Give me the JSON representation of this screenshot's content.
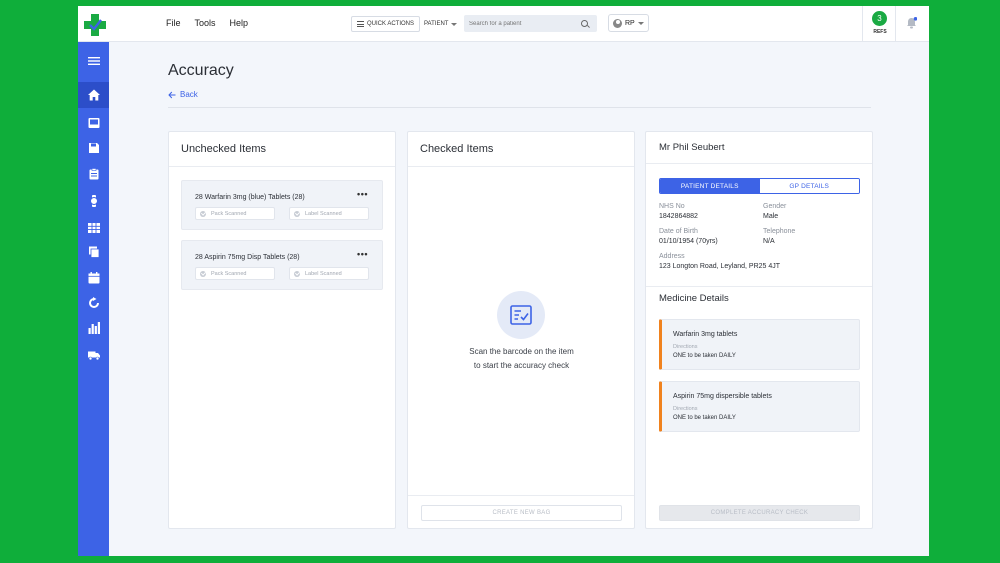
{
  "topbar": {
    "menu": [
      "File",
      "Tools",
      "Help"
    ],
    "quick_actions": "QUICK ACTIONS",
    "patient_selector": "PATIENT",
    "search_placeholder": "Search for a patient",
    "user_initials": "RP",
    "refs_count": "3",
    "refs_label": "REFS"
  },
  "page": {
    "title": "Accuracy",
    "back": "Back"
  },
  "unchecked": {
    "title": "Unchecked Items",
    "items": [
      {
        "name": "28 Warfarin 3mg (blue) Tablets (28)",
        "pack": "Pack Scanned",
        "label": "Label Scanned"
      },
      {
        "name": "28 Aspirin 75mg Disp Tablets (28)",
        "pack": "Pack Scanned",
        "label": "Label Scanned"
      }
    ]
  },
  "checked": {
    "title": "Checked Items",
    "empty_line1": "Scan the barcode on the item",
    "empty_line2": "to start the accuracy check",
    "create_bag": "CREATE NEW BAG"
  },
  "patient": {
    "name": "Mr Phil Seubert",
    "tab_patient": "PATIENT DETAILS",
    "tab_gp": "GP DETAILS",
    "nhs_label": "NHS No",
    "nhs_value": "1842864882",
    "gender_label": "Gender",
    "gender_value": "Male",
    "dob_label": "Date of Birth",
    "dob_value": "01/10/1954 (70yrs)",
    "tel_label": "Telephone",
    "tel_value": "N/A",
    "address_label": "Address",
    "address_value": "123 Longton Road, Leyland, PR25 4JT",
    "medicine_title": "Medicine Details",
    "medicines": [
      {
        "name": "Warfarin 3mg tablets",
        "dir_label": "Directions",
        "dir_value": "ONE to be taken DAILY"
      },
      {
        "name": "Aspirin 75mg dispersible tablets",
        "dir_label": "Directions",
        "dir_value": "ONE to be taken DAILY"
      }
    ],
    "complete": "COMPLETE ACCURACY CHECK"
  },
  "colors": {
    "accent": "#3d63e6",
    "brand_green": "#0fae3a",
    "medicine_stripe": "#f0821e"
  },
  "sidebar_icons": [
    "menu-icon",
    "home-icon",
    "inbox-icon",
    "save-icon",
    "clipboard-icon",
    "watch-icon",
    "grid-icon",
    "document-stack-icon",
    "calendar-icon",
    "refresh-icon",
    "bar-chart-icon",
    "truck-icon"
  ]
}
